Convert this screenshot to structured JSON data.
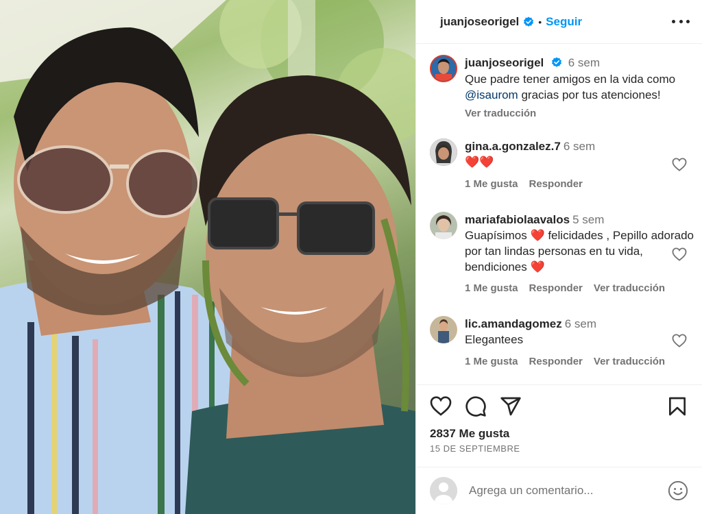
{
  "header": {
    "username": "juanjoseorigel",
    "separator": "•",
    "follow_label": "Seguir"
  },
  "caption": {
    "username": "juanjoseorigel",
    "time": "6 sem",
    "text_before": "Que padre tener amigos en la vida como ",
    "mention": "@isaurom",
    "text_after": " gracias por tus atenciones!",
    "translate_label": "Ver traducción"
  },
  "comments": [
    {
      "username": "gina.a.gonzalez.7",
      "time": "6 sem",
      "text": "❤️❤️",
      "likes": "1 Me gusta",
      "reply": "Responder",
      "translate": ""
    },
    {
      "username": "mariafabiolaavalos",
      "time": "5 sem",
      "text_1": "Guapísimos ",
      "text_2": " felicidades , Pepillo adorado por tan lindas personas en tu vida, bendiciones ",
      "heart": "❤️",
      "likes": "1 Me gusta",
      "reply": "Responder",
      "translate": "Ver traducción"
    },
    {
      "username": "lic.amandagomez",
      "time": "6 sem",
      "text": "Elegantees",
      "likes": "1 Me gusta",
      "reply": "Responder",
      "translate": "Ver traducción"
    }
  ],
  "post": {
    "likes": "2837 Me gusta",
    "date": "15 DE SEPTIEMBRE"
  },
  "add_comment": {
    "placeholder": "Agrega un comentario..."
  },
  "icons": [
    "verified-badge-icon",
    "more-options-icon",
    "like-heart-icon",
    "comment-icon",
    "share-icon",
    "save-bookmark-icon",
    "emoji-icon"
  ],
  "colors": {
    "accent": "#0095f6",
    "text": "#262626",
    "secondary": "#737373",
    "heart": "#ed2f3d"
  }
}
